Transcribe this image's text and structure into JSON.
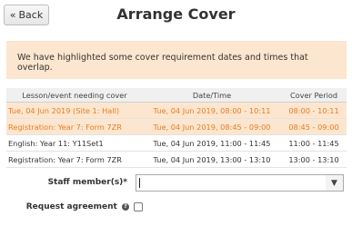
{
  "header": {
    "back_label": "Back",
    "back_icon": "«",
    "title": "Arrange Cover"
  },
  "alert": {
    "message": "We have highlighted some cover requirement dates and times that overlap."
  },
  "table": {
    "headers": [
      "Lesson/event needing cover",
      "Date/Time",
      "Cover Period"
    ],
    "rows": [
      {
        "lesson": "Tue, 04 Jun 2019 (Site 1: Hall)",
        "datetime": "Tue, 04 Jun 2019, 08:00 - 10:11",
        "period": "08:00 - 10:11",
        "highlighted": true
      },
      {
        "lesson": "Registration: Year 7: Form 7ZR",
        "datetime": "Tue, 04 Jun 2019, 08:45 - 09:00",
        "period": "08:45 - 09:00",
        "highlighted": true
      },
      {
        "lesson": "English: Year 11: Y11Set1",
        "datetime": "Tue, 04 Jun 2019, 11:00 - 11:45",
        "period": "11:00 - 11:45",
        "highlighted": false
      },
      {
        "lesson": "Registration: Year 7: Form 7ZR",
        "datetime": "Tue, 04 Jun 2019, 13:00 - 13:10",
        "period": "13:00 - 13:10",
        "highlighted": false
      }
    ]
  },
  "form": {
    "staff_label": "Staff member(s)*",
    "staff_value": "",
    "dropdown_icon": "▼",
    "agreement_label": "Request agreement",
    "help_icon": "?",
    "agreement_checked": false
  },
  "colors": {
    "highlight_bg": "#fde6cf",
    "highlight_text": "#e67e22"
  }
}
